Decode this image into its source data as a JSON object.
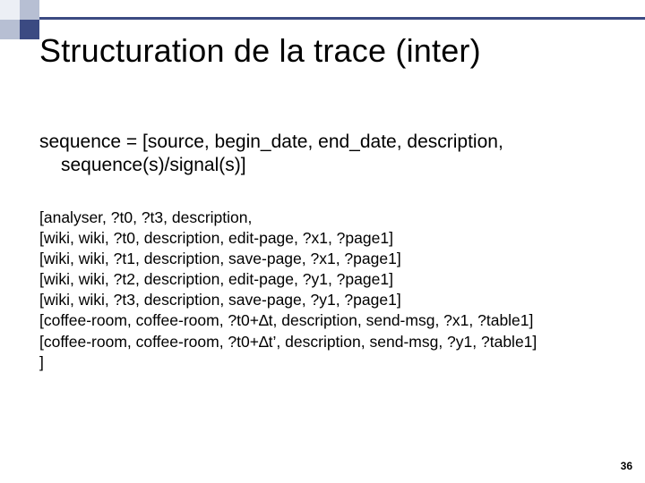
{
  "title": "Structuration de la trace (inter)",
  "def": {
    "line1": "sequence = [source, begin_date, end_date, description,",
    "line2": "sequence(s)/signal(s)]"
  },
  "trace": {
    "l0": "[analyser, ?t0, ?t3, description,",
    "l1": "[wiki, wiki, ?t0, description, edit-page, ?x1, ?page1]",
    "l2": "[wiki, wiki, ?t1, description, save-page, ?x1, ?page1]",
    "l3": "[wiki, wiki, ?t2, description, edit-page, ?y1, ?page1]",
    "l4": "[wiki, wiki, ?t3, description, save-page, ?y1, ?page1]",
    "l5": "[coffee-room, coffee-room, ?t0+∆t, description, send-msg, ?x1, ?table1]",
    "l6": "[coffee-room, coffee-room, ?t0+∆t’, description, send-msg, ?y1, ?table1]",
    "l7": "]"
  },
  "pagenum": "36"
}
